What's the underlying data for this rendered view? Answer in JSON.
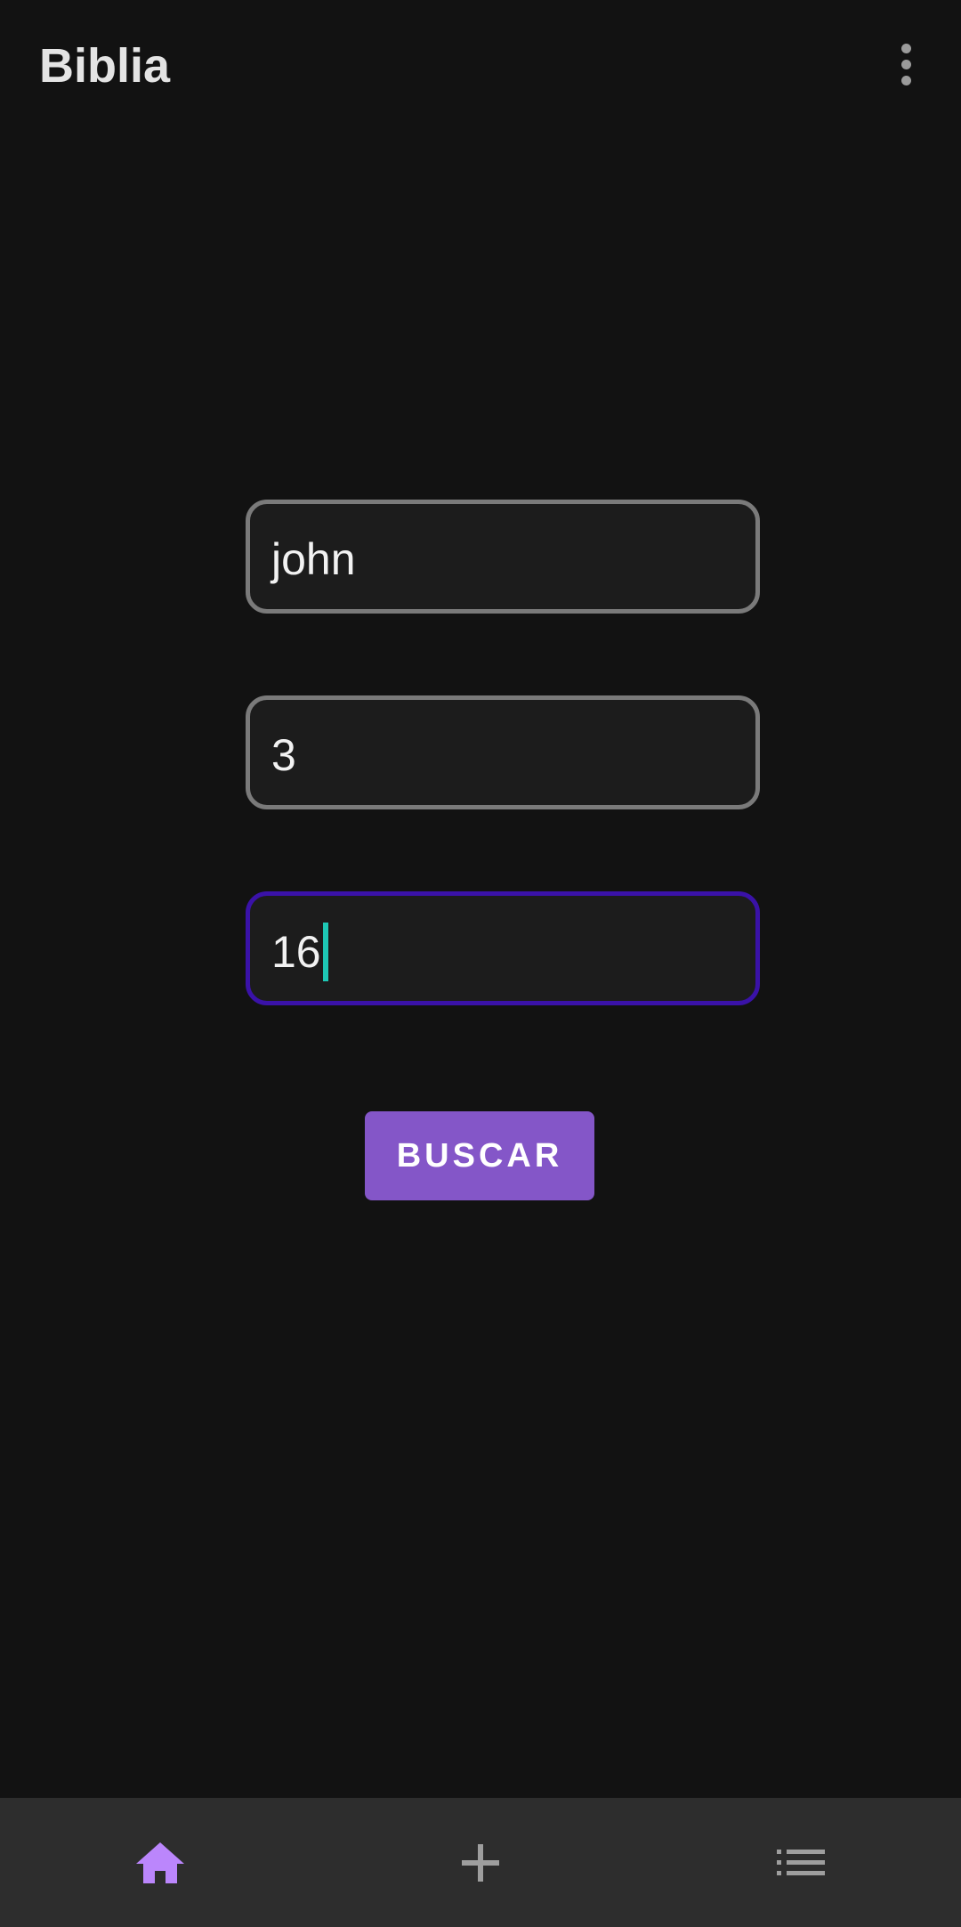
{
  "app_bar": {
    "title": "Biblia",
    "overflow_icon": "more-vert-icon"
  },
  "form": {
    "book": {
      "value": "john"
    },
    "chapter": {
      "value": "3"
    },
    "verse": {
      "value": "16",
      "focused": true
    },
    "search_button_label": "BUSCAR"
  },
  "bottom_nav": {
    "items": [
      {
        "icon": "home-icon",
        "selected": true
      },
      {
        "icon": "add-icon",
        "selected": false
      },
      {
        "icon": "list-icon",
        "selected": false
      }
    ]
  },
  "colors": {
    "background": "#121212",
    "accent": "#8456c8",
    "selected_nav": "#bb86fc",
    "focus_border": "#3a12a8",
    "caret": "#1ec8b5"
  }
}
